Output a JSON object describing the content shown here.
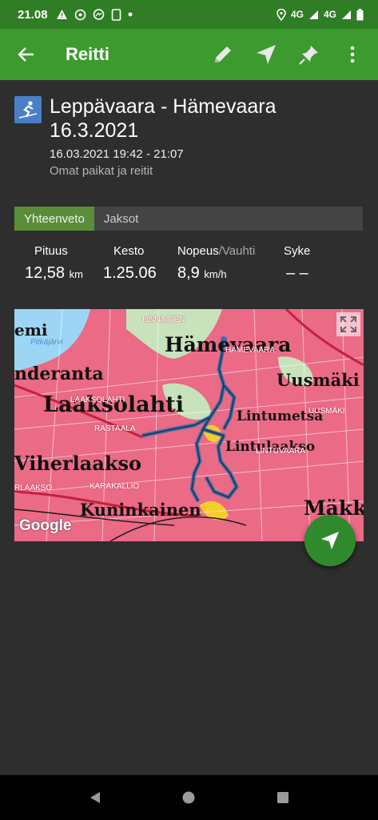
{
  "status": {
    "time": "21.08",
    "notifications": [
      "warning-icon",
      "whatsapp-icon",
      "messenger-icon",
      "phone-icon",
      "dot-icon"
    ],
    "network_a": "4G",
    "network_b": "4G"
  },
  "appbar": {
    "title": "Reitti",
    "actions": [
      "edit-icon",
      "navigate-icon",
      "pin-icon",
      "more-icon"
    ]
  },
  "route": {
    "name": "Leppävaara - Hämevaara 16.3.2021",
    "time_range": "16.03.2021 19:42 - 21:07",
    "category": "Omat paikat ja reitit"
  },
  "tabs": [
    {
      "label": "Yhteenveto",
      "active": true
    },
    {
      "label": "Jaksot",
      "active": false
    }
  ],
  "stats": {
    "distance": {
      "label": "Pituus",
      "value": "12,58",
      "unit": "km"
    },
    "duration": {
      "label": "Kesto",
      "value": "1.25.06"
    },
    "speed": {
      "label": "Nopeus",
      "label_alt": "/Vauhti",
      "value": "8,9",
      "unit": "km/h"
    },
    "heart_rate": {
      "label": "Syke",
      "value": "– –"
    }
  },
  "map": {
    "places": {
      "hamevaara": "Hämevaara",
      "uusmaki": "Uusmäki",
      "laaksolahti": "Laaksolahti",
      "viherlaakso": "Viherlaakso",
      "kuninkainen": "Kuninkainen",
      "lintumetsa": "Lintumetsä",
      "lintulaakso": "Lintulaakso",
      "mak": "Mäkk",
      "nderanta": "nderanta",
      "emi": "emi"
    },
    "small_labels": {
      "linnainen": "LINNAINEN",
      "hamevaara_small": "HÄMEVAARA",
      "uusmaki_small": "UUSMÄKI",
      "laaksolahti_small": "LAAKSOLAHTI",
      "rastaala": "RASTAALA",
      "lintuvaara": "LINTUVAARA",
      "karakallio": "KARAKALLIO",
      "laakso_small": "RLAAKSO",
      "pitkajarvi": "Pitkäjärvi"
    },
    "attribution": "Google",
    "colors": {
      "urban": "#eb6a86",
      "water": "#9dd6f5",
      "route": "#3f6fa8",
      "forest": "#c8e3bb"
    }
  }
}
